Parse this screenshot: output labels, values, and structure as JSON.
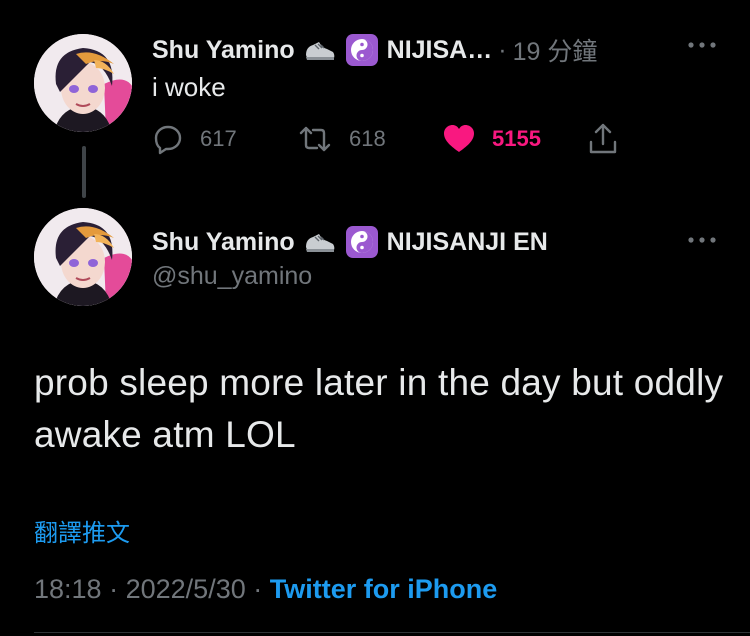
{
  "reply_tweet": {
    "display_name": "Shu Yamino",
    "affiliation": "NIJISA…",
    "separator": "·",
    "time_ago": "19 分鐘",
    "text": "i woke",
    "reply_count": "617",
    "retweet_count": "618",
    "like_count": "5155",
    "liked": true,
    "icons": [
      "sneaker-icon",
      "yin-yang-icon",
      "more-icon",
      "reply-icon",
      "retweet-icon",
      "heart-icon",
      "share-icon"
    ]
  },
  "main_tweet": {
    "display_name": "Shu Yamino",
    "affiliation": "NIJISANJI EN",
    "handle": "@shu_yamino",
    "text": "prob sleep more later in the day but oddly awake atm LOL",
    "translate_label": "翻譯推文",
    "time": "18:18",
    "separator": "·",
    "date": "2022/5/30",
    "source": "Twitter for iPhone"
  },
  "colors": {
    "background": "#000000",
    "text_primary": "#e7e9ea",
    "text_secondary": "#71767b",
    "accent_blue": "#1d9bf0",
    "like_pink": "#f91880",
    "yin_yang_badge": "#9b59d0"
  }
}
